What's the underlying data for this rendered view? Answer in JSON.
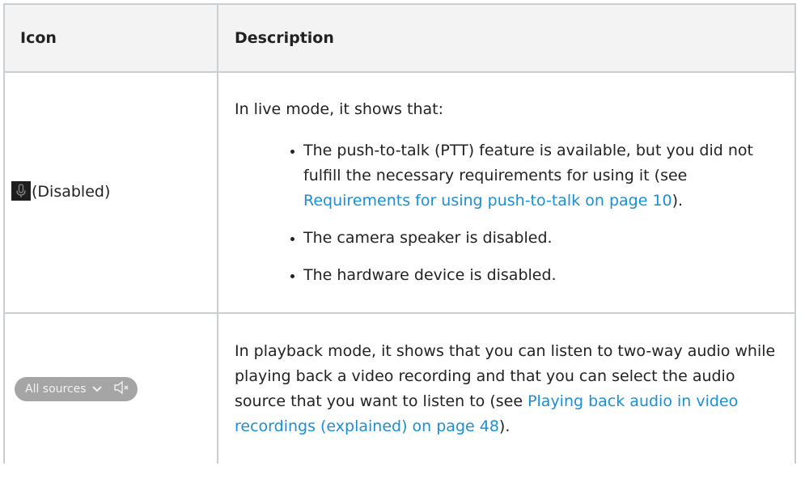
{
  "table": {
    "headers": {
      "icon": "Icon",
      "description": "Description"
    },
    "rows": [
      {
        "icon_label": "(Disabled)",
        "intro": "In live mode, it shows that:",
        "bullets": [
          {
            "text_before": "The push-to-talk (PTT) feature is available, but you did not fulfill the necessary requirements for using it (see ",
            "link": "Requirements for using push-to-talk on page 10",
            "text_after": ")."
          },
          {
            "text": "The camera speaker is disabled."
          },
          {
            "text": "The hardware device is disabled."
          }
        ]
      },
      {
        "icon_widget": {
          "label": "All sources"
        },
        "text_before": "In playback mode, it shows that you can listen to two-way audio while playing back a video recording and that you can select the audio source that you want to listen to (see ",
        "link": "Playing back audio in video recordings (explained) on page 48",
        "text_after": ")."
      }
    ]
  },
  "icons": {
    "mic": "microphone-disabled-icon",
    "chevron": "chevron-down-icon",
    "speaker": "speaker-muted-icon"
  }
}
